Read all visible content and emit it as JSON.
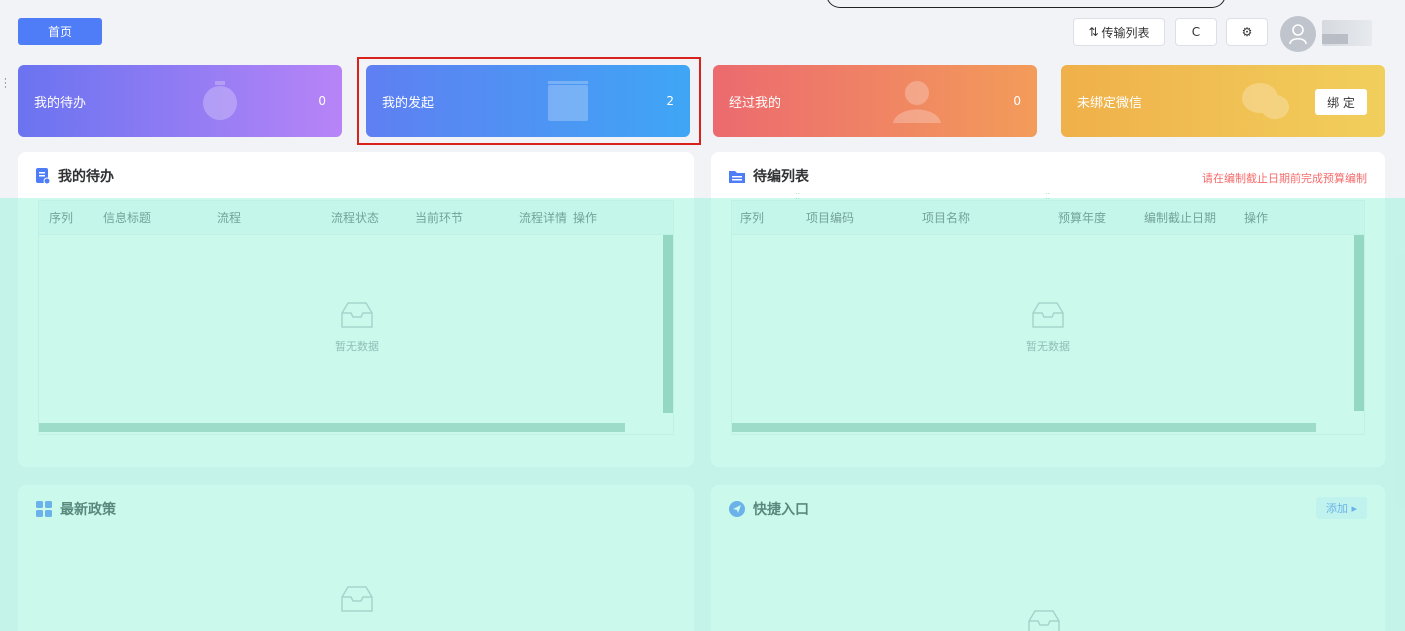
{
  "topbar": {
    "home_tab": "首页",
    "transfer_list": "传输列表",
    "refresh_icon": "C",
    "settings_icon": "gear-icon",
    "avatar_icon": "user-icon"
  },
  "stats": [
    {
      "label": "我的待办",
      "count": "0",
      "color_from": "#6a73f0",
      "color_to": "#b784f7"
    },
    {
      "label": "我的发起",
      "count": "2",
      "color_from": "#5f7ff2",
      "color_to": "#3fa6f5"
    },
    {
      "label": "经过我的",
      "count": "0",
      "color_from": "#ec6a6f",
      "color_to": "#f39c5a"
    },
    {
      "label": "未绑定微信",
      "bind_button": "绑 定",
      "color_from": "#f0b04a",
      "color_to": "#f1cf5c"
    }
  ],
  "todo_panel": {
    "title": "我的待办",
    "columns": [
      "序列",
      "信息标题",
      "流程",
      "流程状态",
      "当前环节",
      "流程详情",
      "操作"
    ],
    "empty_text": "暂无数据"
  },
  "edit_panel": {
    "title": "待编列表",
    "notice": "请在编制截止日期前完成预算编制",
    "columns": [
      "序列",
      "项目编码",
      "项目名称",
      "预算年度",
      "编制截止日期",
      "操作"
    ],
    "empty_text": "暂无数据"
  },
  "policy_panel": {
    "title": "最新政策"
  },
  "shortcut_panel": {
    "title": "快捷入口",
    "add_button": "添加 ▸"
  },
  "colors": {
    "primary": "#4f7cf7",
    "highlight_border": "#d9221c",
    "overlay": "#8cf4d6"
  }
}
